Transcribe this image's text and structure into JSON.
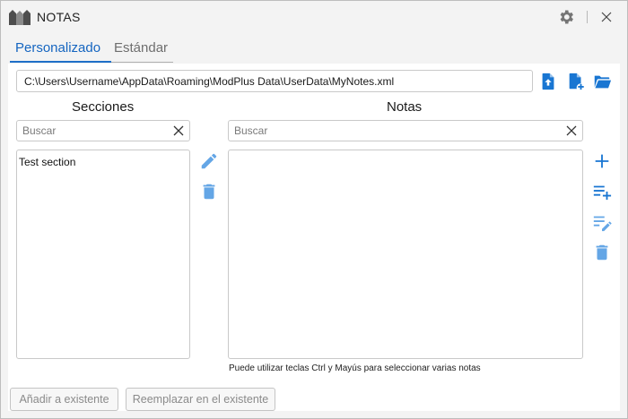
{
  "window": {
    "title": "NOTAS",
    "colors": {
      "accent": "#1e6fc8",
      "icon_blue": "#1976d2",
      "icon_light": "#64a6e6",
      "gear": "#757575"
    }
  },
  "tabs": [
    {
      "label": "Personalizado",
      "active": true
    },
    {
      "label": "Estándar",
      "active": false
    }
  ],
  "file": {
    "path": "C:\\Users\\Username\\AppData\\Roaming\\ModPlus Data\\UserData\\MyNotes.xml",
    "actions": [
      "upload-file-icon",
      "new-file-icon",
      "open-folder-icon"
    ]
  },
  "sections": {
    "title": "Secciones",
    "search_placeholder": "Buscar",
    "items": [
      "Test section"
    ],
    "actions": [
      "edit-icon",
      "delete-icon"
    ]
  },
  "notes": {
    "title": "Notas",
    "search_placeholder": "Buscar",
    "items": [],
    "hint": "Puede utilizar teclas Ctrl y Mayús para seleccionar varias notas",
    "actions": [
      "add-icon",
      "add-list-icon",
      "edit-list-icon",
      "delete-icon"
    ]
  },
  "footer": {
    "add_label": "Añadir a existente",
    "replace_label": "Reemplazar en el existente"
  }
}
